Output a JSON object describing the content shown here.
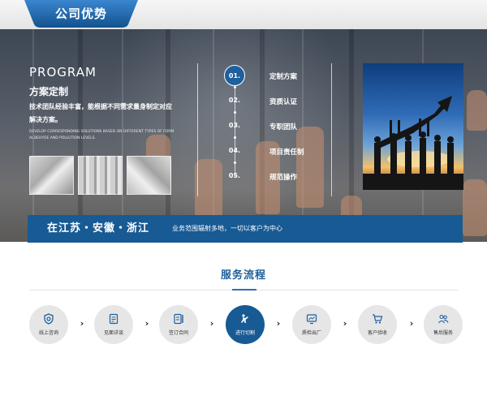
{
  "header": {
    "tab_label": "公司优势"
  },
  "program": {
    "title": "PROGRAM",
    "subtitle": "方案定制",
    "description": "技术团队经验丰富，能根据不同需求量身制定对应解决方案。",
    "english": "DEVELOP CORRESPONDING SOLUTIONS BASED ON DIFFERENT TYPES OF FORM ALDEHYDE AND POLLUTION LEVELS."
  },
  "steps": [
    {
      "num": "01.",
      "label": "定制方案",
      "active": true
    },
    {
      "num": "02.",
      "label": "资质认证",
      "active": false
    },
    {
      "num": "03.",
      "label": "专职团队",
      "active": false
    },
    {
      "num": "04.",
      "label": "项目责任制",
      "active": false
    },
    {
      "num": "05.",
      "label": "规范操作",
      "active": false
    }
  ],
  "banner": {
    "title": "在江苏・安徽・浙江",
    "text": "业务范围辐射多地，一切以客户为中心"
  },
  "service": {
    "title": "服务流程",
    "items": [
      {
        "label": "线上咨询",
        "icon": "consult-icon",
        "active": false
      },
      {
        "label": "见面详谈",
        "icon": "document-icon",
        "active": false
      },
      {
        "label": "签订合同",
        "icon": "contract-icon",
        "active": false
      },
      {
        "label": "进行切割",
        "icon": "cutting-icon",
        "active": true
      },
      {
        "label": "质检出厂",
        "icon": "monitor-icon",
        "active": false
      },
      {
        "label": "客户验收",
        "icon": "cart-icon",
        "active": false
      },
      {
        "label": "售后服务",
        "icon": "users-icon",
        "active": false
      }
    ]
  },
  "colors": {
    "primary": "#175a94",
    "accent": "#2c71b3",
    "title": "#1c5e99"
  }
}
